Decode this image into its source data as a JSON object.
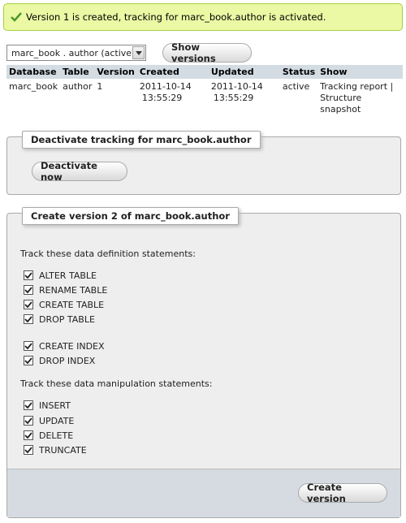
{
  "message": {
    "text": "Version 1 is created, tracking for marc_book.author is activated.",
    "icon": "check-icon"
  },
  "selector": {
    "value": "marc_book . author (active)"
  },
  "show_versions_label": "Show versions",
  "table": {
    "headers": [
      "Database",
      "Table",
      "Version",
      "Created",
      "Updated",
      "Status",
      "Show"
    ],
    "row": {
      "database": "marc_book",
      "table": "author",
      "version": "1",
      "created_date": "2011-10-14",
      "created_time": "13:55:29",
      "updated_date": "2011-10-14",
      "updated_time": "13:55:29",
      "status": "active",
      "tracking_report": "Tracking report",
      "separator": " |",
      "structure_snapshot": "Structure snapshot"
    }
  },
  "deactivate": {
    "legend": "Deactivate tracking for marc_book.author",
    "button": "Deactivate now"
  },
  "create": {
    "legend": "Create version 2 of marc_book.author",
    "ddl_label": "Track these data definition statements:",
    "ddl": [
      "ALTER TABLE",
      "RENAME TABLE",
      "CREATE TABLE",
      "DROP TABLE",
      "CREATE INDEX",
      "DROP INDEX"
    ],
    "dml_label": "Track these data manipulation statements:",
    "dml": [
      "INSERT",
      "UPDATE",
      "DELETE",
      "TRUNCATE"
    ],
    "button": "Create version"
  }
}
